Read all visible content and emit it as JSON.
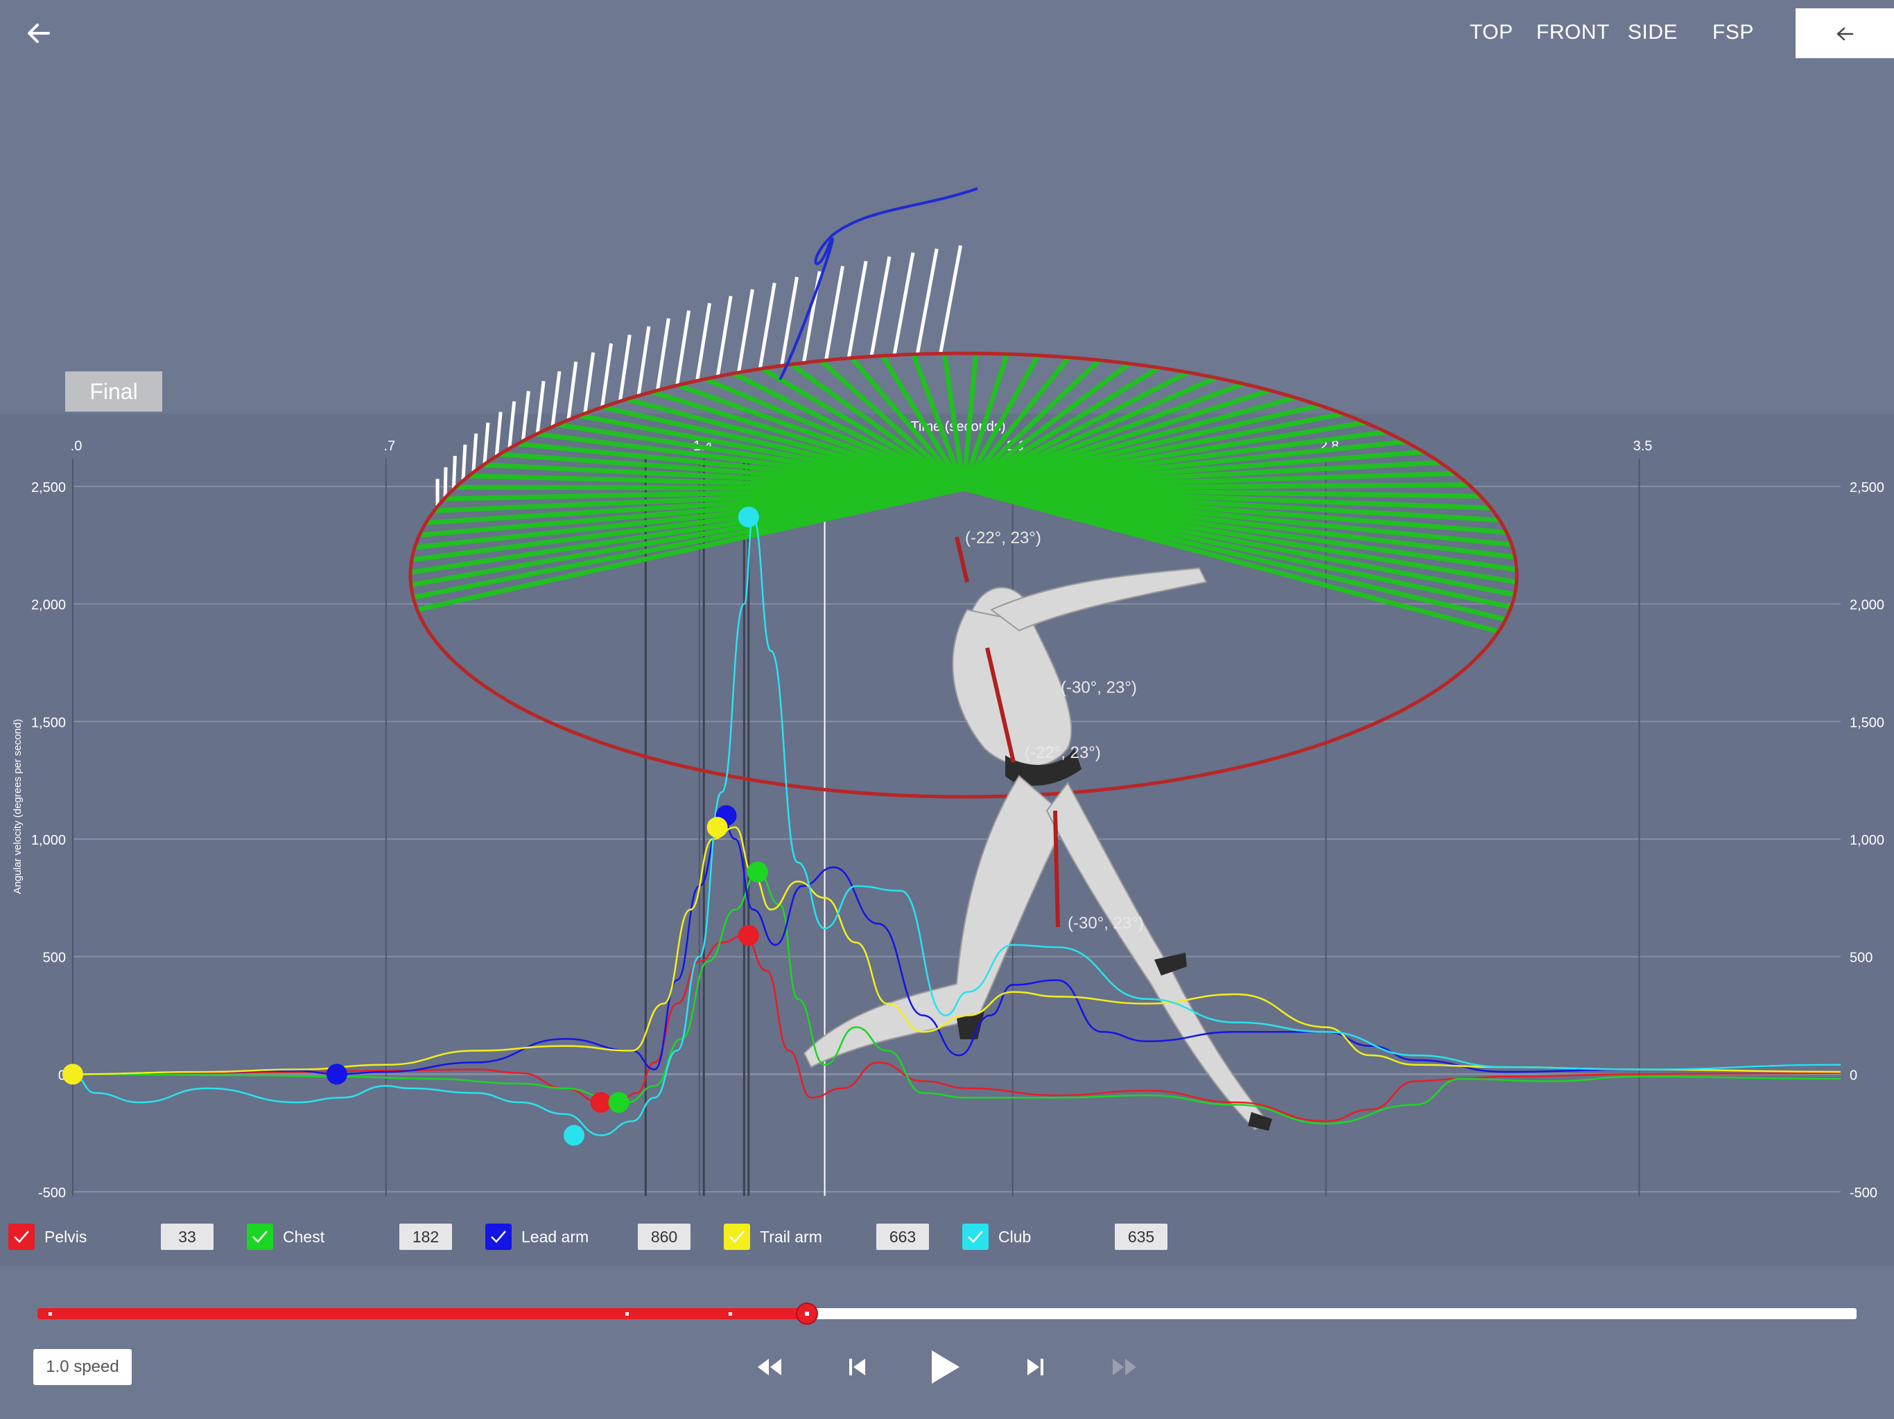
{
  "nav": {
    "views": [
      "TOP",
      "FRONT",
      "SIDE",
      "FSP"
    ]
  },
  "badge": "Final",
  "scene_labels": [
    "(-22°, 23°)",
    "(-30°, 23°)",
    "(-22°, 23°)",
    "(-30°, 23°)"
  ],
  "chart_data": {
    "type": "line",
    "xlabel": "Time (seconds)",
    "ylabel": "Angular velocity (degrees per second)",
    "x_ticks": [
      ".0",
      ".7",
      "1.4",
      "2.1",
      "2.8",
      "3.5"
    ],
    "x_tick_values": [
      0,
      0.7,
      1.4,
      2.1,
      2.8,
      3.5
    ],
    "xlim": [
      0,
      3.95
    ],
    "y_ticks": [
      "2,500",
      "2,000",
      "1,500",
      "1,000",
      "500",
      "0",
      "-500"
    ],
    "y_tick_values": [
      2500,
      2000,
      1500,
      1000,
      500,
      0,
      -500
    ],
    "ylim": [
      -500,
      2500
    ],
    "grid": true,
    "event_markers": [
      1.28,
      1.41,
      1.5,
      1.51,
      1.68
    ],
    "current_time": 1.68,
    "series": [
      {
        "name": "Pelvis",
        "color": "#e81d25",
        "x": [
          0,
          0.3,
          0.5,
          0.7,
          0.9,
          1.0,
          1.1,
          1.18,
          1.22,
          1.26,
          1.3,
          1.35,
          1.4,
          1.45,
          1.5,
          1.55,
          1.6,
          1.65,
          1.72,
          1.8,
          1.9,
          2.0,
          2.2,
          2.4,
          2.6,
          2.8,
          2.9,
          3.0,
          3.1,
          3.2,
          3.5,
          3.95
        ],
        "y": [
          0,
          5,
          10,
          15,
          20,
          5,
          -60,
          -120,
          -120,
          -80,
          50,
          300,
          480,
          560,
          590,
          440,
          100,
          -100,
          -60,
          50,
          -30,
          -60,
          -90,
          -70,
          -120,
          -200,
          -150,
          -30,
          -20,
          -10,
          0,
          5
        ],
        "peak": {
          "x": 1.51,
          "y": 590
        },
        "start": {
          "x": 1.18,
          "y": -120
        }
      },
      {
        "name": "Chest",
        "color": "#1cd623",
        "x": [
          0,
          0.4,
          0.6,
          0.8,
          1.0,
          1.1,
          1.2,
          1.24,
          1.3,
          1.36,
          1.42,
          1.48,
          1.53,
          1.58,
          1.62,
          1.68,
          1.75,
          1.82,
          1.9,
          2.0,
          2.2,
          2.4,
          2.6,
          2.8,
          3.0,
          3.1,
          3.3,
          3.5,
          3.95
        ],
        "y": [
          0,
          -5,
          -10,
          -20,
          -40,
          -60,
          -100,
          -120,
          -50,
          150,
          480,
          700,
          860,
          720,
          320,
          40,
          200,
          100,
          -80,
          -100,
          -100,
          -90,
          -130,
          -210,
          -130,
          -20,
          -30,
          -10,
          -20
        ],
        "peak": {
          "x": 1.53,
          "y": 860
        },
        "start": {
          "x": 1.22,
          "y": -120
        }
      },
      {
        "name": "Lead arm",
        "color": "#1414e6",
        "x": [
          0,
          0.3,
          0.5,
          0.59,
          0.7,
          0.9,
          1.1,
          1.25,
          1.3,
          1.35,
          1.4,
          1.45,
          1.48,
          1.52,
          1.57,
          1.63,
          1.7,
          1.8,
          1.9,
          1.98,
          2.05,
          2.1,
          2.2,
          2.3,
          2.4,
          2.6,
          2.8,
          2.9,
          3.0,
          3.2,
          3.5,
          3.95
        ],
        "y": [
          0,
          10,
          15,
          0,
          10,
          50,
          150,
          100,
          20,
          400,
          800,
          1100,
          1000,
          700,
          550,
          800,
          880,
          640,
          250,
          80,
          250,
          380,
          400,
          180,
          140,
          180,
          180,
          120,
          60,
          10,
          20,
          40
        ],
        "peak": {
          "x": 1.46,
          "y": 1100
        },
        "start": {
          "x": 0.59,
          "y": 0
        }
      },
      {
        "name": "Trail arm",
        "color": "#f4ef1a",
        "x": [
          0,
          0.3,
          0.5,
          0.7,
          0.9,
          1.1,
          1.25,
          1.32,
          1.38,
          1.43,
          1.48,
          1.52,
          1.56,
          1.62,
          1.68,
          1.75,
          1.82,
          1.9,
          2.0,
          2.1,
          2.2,
          2.4,
          2.6,
          2.8,
          2.9,
          3.0,
          3.2,
          3.5,
          3.95
        ],
        "y": [
          0,
          10,
          20,
          40,
          100,
          120,
          100,
          300,
          700,
          1000,
          1050,
          850,
          700,
          820,
          750,
          560,
          300,
          180,
          250,
          350,
          330,
          300,
          340,
          200,
          80,
          40,
          30,
          20,
          10
        ],
        "peak": {
          "x": 1.44,
          "y": 1050
        },
        "start": {
          "x": 0.0,
          "y": 0
        }
      },
      {
        "name": "Club",
        "color": "#28e3ee",
        "x": [
          0,
          0.05,
          0.15,
          0.3,
          0.5,
          0.6,
          0.7,
          0.75,
          0.9,
          1.0,
          1.1,
          1.18,
          1.25,
          1.3,
          1.35,
          1.4,
          1.45,
          1.5,
          1.52,
          1.56,
          1.62,
          1.68,
          1.75,
          1.85,
          1.95,
          2.0,
          2.1,
          2.2,
          2.4,
          2.6,
          2.8,
          3.0,
          3.2,
          3.5,
          3.95
        ],
        "y": [
          0,
          -80,
          -120,
          -60,
          -120,
          -100,
          -50,
          -60,
          -80,
          -120,
          -170,
          -260,
          -200,
          -100,
          100,
          500,
          1200,
          2000,
          2370,
          1800,
          900,
          620,
          800,
          780,
          250,
          350,
          550,
          540,
          320,
          220,
          180,
          80,
          30,
          20,
          40
        ],
        "peak": {
          "x": 1.51,
          "y": 2370
        },
        "start": {
          "x": 1.12,
          "y": -260
        }
      }
    ]
  },
  "legend": [
    {
      "label": "Pelvis",
      "value": "33",
      "color": "#e81d25"
    },
    {
      "label": "Chest",
      "value": "182",
      "color": "#1cd623"
    },
    {
      "label": "Lead arm",
      "value": "860",
      "color": "#1414e6"
    },
    {
      "label": "Trail arm",
      "value": "663",
      "color": "#f4ef1a"
    },
    {
      "label": "Club",
      "value": "635",
      "color": "#28e3ee"
    }
  ],
  "playback": {
    "speed_label": "1.0 speed",
    "progress": 0.423,
    "markers": [
      0.006,
      0.323,
      0.38
    ]
  }
}
